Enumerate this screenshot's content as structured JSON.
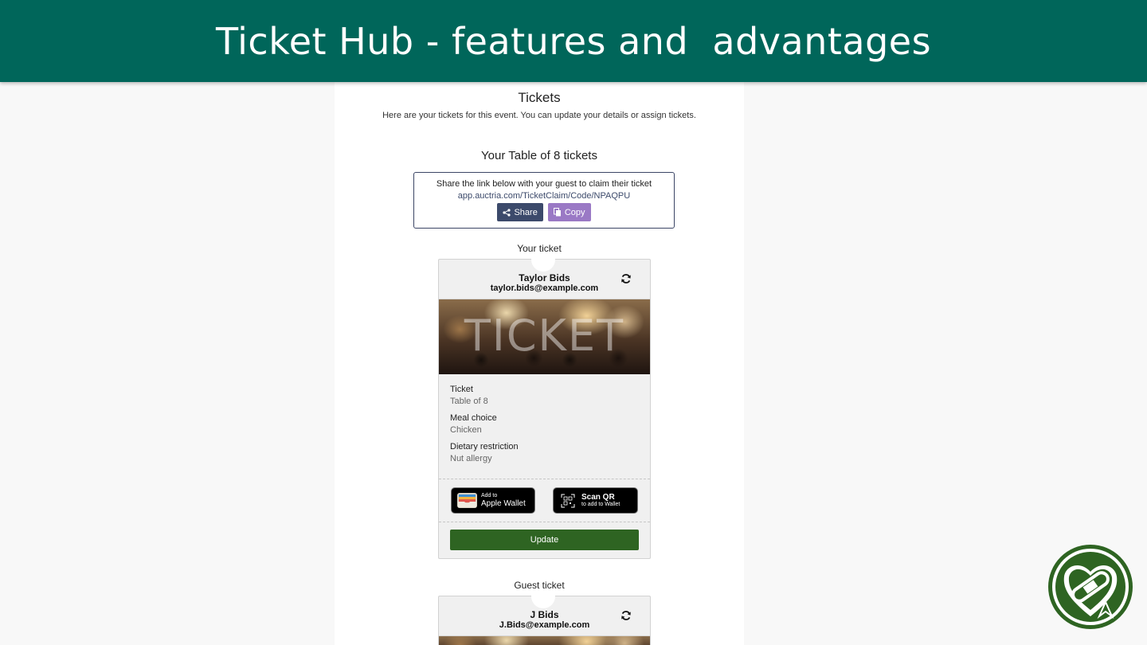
{
  "banner": {
    "title": "Ticket Hub - features and  advantages"
  },
  "page": {
    "title": "Tickets",
    "subtitle": "Here are your tickets for this event. You can update your details or assign tickets.",
    "table_title": "Your Table of 8 tickets"
  },
  "share": {
    "text": "Share the link below with your guest to claim their ticket",
    "link": "app.auctria.com/TicketClaim/Code/NPAQPU",
    "share_label": "Share",
    "copy_label": "Copy"
  },
  "your_ticket": {
    "section_label": "Your ticket",
    "name": "Taylor Bids",
    "email": "taylor.bids@example.com",
    "image_text": "TICKET",
    "ticket_label": "Ticket",
    "ticket_value": "Table of 8",
    "meal_label": "Meal choice",
    "meal_value": "Chicken",
    "dietary_label": "Dietary restriction",
    "dietary_value": "Nut allergy",
    "wallet_small": "Add to",
    "wallet_big": "Apple Wallet",
    "qr_title": "Scan QR",
    "qr_sub": "to add to Wallet",
    "update_label": "Update"
  },
  "guest_ticket": {
    "section_label": "Guest ticket",
    "name": "J Bids",
    "email": "J.Bids@example.com"
  },
  "colors": {
    "banner": "#00665a",
    "share_button": "#3c4a6b",
    "copy_button": "#9a79c5",
    "update_button": "#2e6422"
  },
  "icons": [
    "share-icon",
    "copy-icon",
    "refresh-icon",
    "apple-wallet-icon",
    "qr-scan-icon",
    "heart-bandage-logo-icon"
  ]
}
